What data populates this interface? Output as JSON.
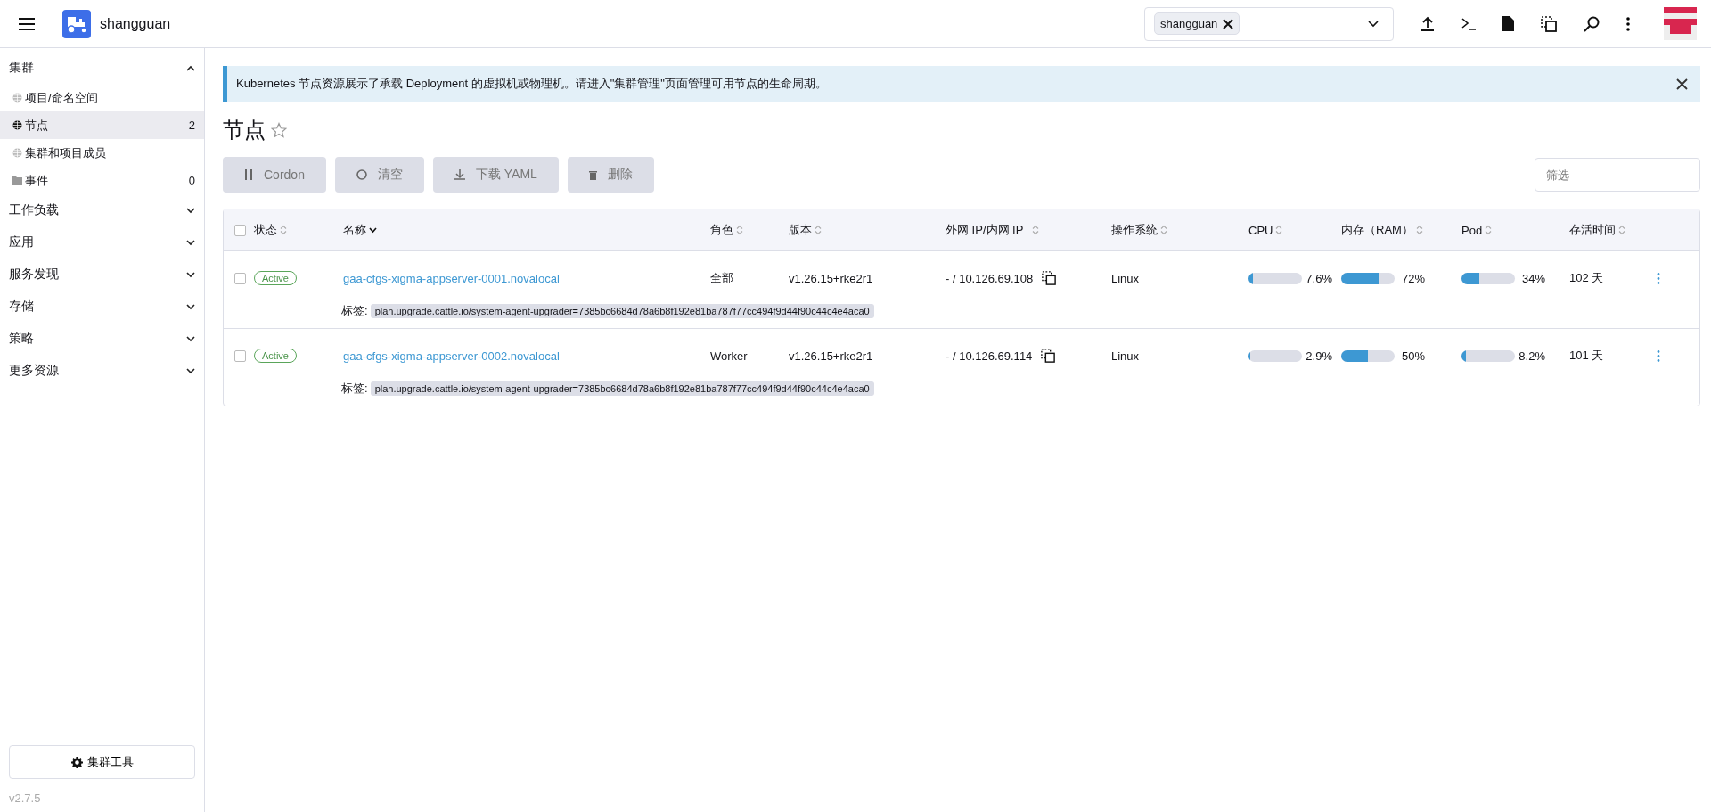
{
  "header": {
    "cluster_name": "shangguan",
    "selector": {
      "chips": [
        "shangguan"
      ]
    }
  },
  "sidebar": {
    "groups": [
      {
        "label": "集群",
        "expanded": true,
        "children": [
          {
            "label": "项目/命名空间",
            "kind": "globe",
            "selected": false
          },
          {
            "label": "节点",
            "kind": "globe",
            "selected": true,
            "count": "2"
          },
          {
            "label": "集群和项目成员",
            "kind": "globe",
            "selected": false
          },
          {
            "label": "事件",
            "kind": "folder",
            "selected": false,
            "count": "0"
          }
        ]
      },
      {
        "label": "工作负载",
        "expanded": false
      },
      {
        "label": "应用",
        "expanded": false
      },
      {
        "label": "服务发现",
        "expanded": false
      },
      {
        "label": "存储",
        "expanded": false
      },
      {
        "label": "策略",
        "expanded": false
      },
      {
        "label": "更多资源",
        "expanded": false
      }
    ],
    "tools_button": "集群工具",
    "version": "v2.7.5"
  },
  "banner": {
    "text": "Kubernetes 节点资源展示了承载 Deployment 的虚拟机或物理机。请进入\"集群管理\"页面管理可用节点的生命周期。"
  },
  "page": {
    "title": "节点"
  },
  "actions": [
    {
      "label": "Cordon",
      "kind": "pause"
    },
    {
      "label": "清空",
      "kind": "drain"
    },
    {
      "label": "下载 YAML",
      "kind": "download"
    },
    {
      "label": "删除",
      "kind": "delete"
    }
  ],
  "filter": {
    "placeholder": "筛选"
  },
  "table": {
    "select_all_checked": false,
    "columns": [
      {
        "label": "状态",
        "sort_active": false
      },
      {
        "label": "名称",
        "sort_active": true
      },
      {
        "label": "角色",
        "sort_active": false
      },
      {
        "label": "版本",
        "sort_active": false
      },
      {
        "label": "外网 IP/内网 IP",
        "sort_active": false
      },
      {
        "label": "操作系统",
        "sort_active": false
      },
      {
        "label": "CPU",
        "sort_active": false
      },
      {
        "label": "内存（RAM）",
        "sort_active": false
      },
      {
        "label": "Pod",
        "sort_active": false
      },
      {
        "label": "存活时间",
        "sort_active": false
      }
    ],
    "rows": [
      {
        "checked": false,
        "state": "Active",
        "name": "gaa-cfgs-xigma-appserver-0001.novalocal",
        "role": "全部",
        "version": "v1.26.15+rke2r1",
        "ip": "- / 10.126.69.108",
        "os": "Linux",
        "cpu": {
          "level": 0.076,
          "reading": "7.6%"
        },
        "ram": {
          "level": 0.72,
          "reading": "72%"
        },
        "pod": {
          "level": 0.34,
          "reading": "34%"
        },
        "age": "102 天",
        "label_caption": "标签:",
        "label": "plan.upgrade.cattle.io/system-agent-upgrader=7385bc6684d78a6b8f192e81ba787f77cc494f9d44f90c44c4e4aca0"
      },
      {
        "checked": false,
        "state": "Active",
        "name": "gaa-cfgs-xigma-appserver-0002.novalocal",
        "role": "Worker",
        "version": "v1.26.15+rke2r1",
        "ip": "- / 10.126.69.114",
        "os": "Linux",
        "cpu": {
          "level": 0.029,
          "reading": "2.9%"
        },
        "ram": {
          "level": 0.5,
          "reading": "50%"
        },
        "pod": {
          "level": 0.082,
          "reading": "8.2%"
        },
        "age": "101 天",
        "label_caption": "标签:",
        "label": "plan.upgrade.cattle.io/system-agent-upgrader=7385bc6684d78a6b8f192e81ba787f77cc494f9d44f90c44c4e4aca0"
      }
    ]
  }
}
